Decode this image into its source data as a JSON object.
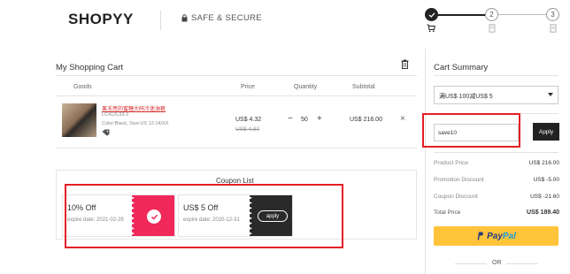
{
  "header": {
    "logo": "SHOPYY",
    "secure_text": "SAFE & SECURE",
    "steps": [
      "2",
      "3"
    ]
  },
  "cart": {
    "title": "My Shopping Cart",
    "columns": [
      "Goods",
      "Price",
      "Quantity",
      "Subtotal"
    ],
    "item": {
      "name": "果冻亮的蜜糖大码冷迷油裤",
      "sku": "LC412L33-2",
      "attributes": "Color:Black, Size:US 12-14/XX",
      "price": "US$ 4.32",
      "old_price": "US$ 4.80",
      "quantity": "50",
      "subtotal": "US$ 216.00",
      "minus": "−",
      "plus": "+",
      "remove": "×"
    }
  },
  "coupons": {
    "title": "Coupon List",
    "items": [
      {
        "name": "10% Off",
        "expire": "expire date: 2021-02-28",
        "selected": true
      },
      {
        "name": "US$ 5 Off",
        "expire": "expire date: 2020-12-31",
        "action": "apply"
      }
    ]
  },
  "summary": {
    "title": "Cart Summary",
    "select_value": "满US$ 100减US$ 5",
    "promo_value": "save10",
    "apply_label": "Apply",
    "rows": [
      {
        "label": "Product Price",
        "value": "US$ 216.00"
      },
      {
        "label": "Promotion Discount",
        "value": "US$ -5.00"
      },
      {
        "label": "Coupon Discount",
        "value": "US$ -21.60"
      },
      {
        "label": "Total Price",
        "value": "US$ 189.40"
      }
    ],
    "paypal_a": "Pay",
    "paypal_b": "Pal",
    "or_text": "OR"
  },
  "colors": {
    "accent_red": "#f0295a",
    "highlight_red": "#e51e25",
    "paypal_yellow": "#ffc43a",
    "dark": "#222222"
  }
}
